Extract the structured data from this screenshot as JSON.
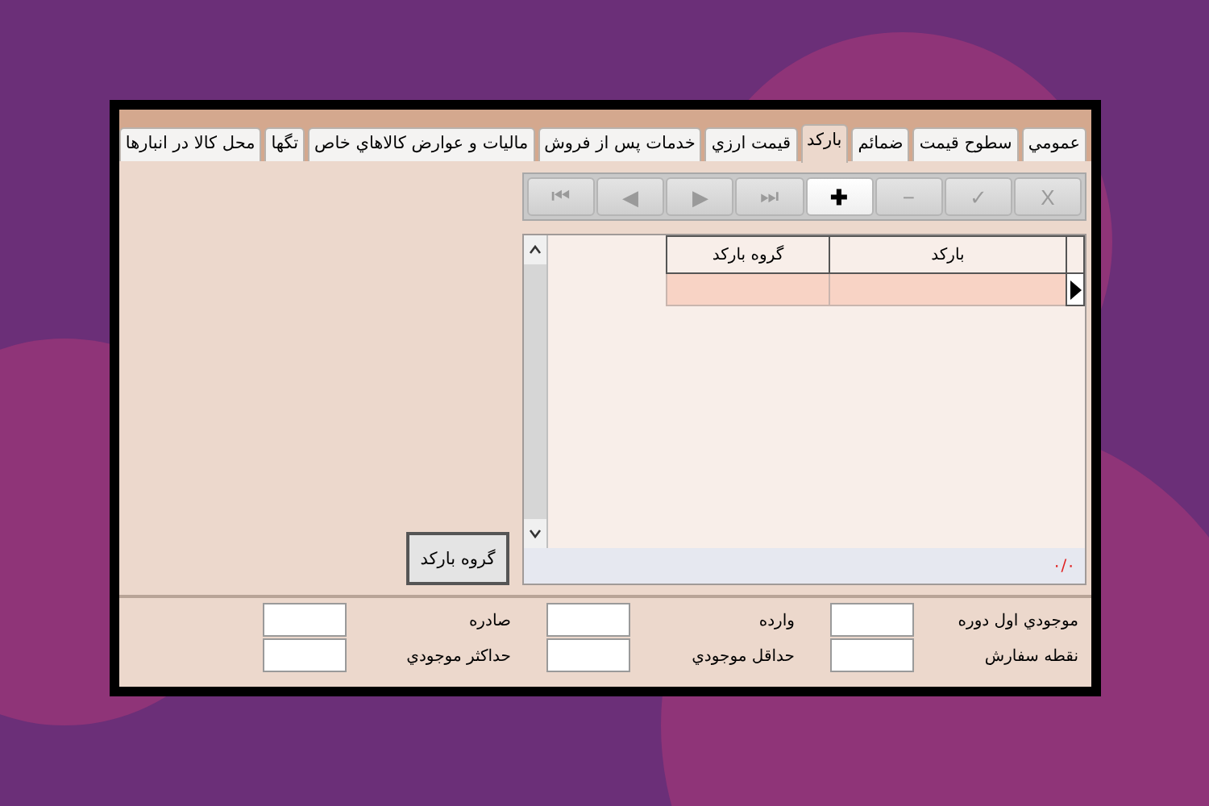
{
  "tabs": [
    {
      "label": "عمومي",
      "selected": false
    },
    {
      "label": "سطوح قيمت",
      "selected": false
    },
    {
      "label": "ضمائم",
      "selected": false
    },
    {
      "label": "بارکد",
      "selected": true
    },
    {
      "label": "قيمت ارزي",
      "selected": false
    },
    {
      "label": "خدمات پس از فروش",
      "selected": false
    },
    {
      "label": "ماليات و عوارض کالاهاي خاص",
      "selected": false
    },
    {
      "label": "تگها",
      "selected": false
    },
    {
      "label": "محل کالا در انبارها",
      "selected": false
    }
  ],
  "toolbar": [
    {
      "symbol": "X",
      "disabled": true
    },
    {
      "symbol": "✓",
      "disabled": true
    },
    {
      "symbol": "−",
      "disabled": true
    },
    {
      "symbol": "✚",
      "disabled": false
    },
    {
      "symbol": "⏭",
      "disabled": true
    },
    {
      "symbol": "▶",
      "disabled": true
    },
    {
      "symbol": "◀",
      "disabled": true
    },
    {
      "symbol": "⏮",
      "disabled": true
    }
  ],
  "grid": {
    "columns": [
      "بارکد",
      "گروه بارکد"
    ],
    "rows": [
      {
        "selected": true
      }
    ],
    "record_counter": "٠/٠"
  },
  "group_button": "گروه بارکد",
  "stock_fields": [
    {
      "label": "موجودي اول دوره"
    },
    {
      "label": "وارده"
    },
    {
      "label": "صادره"
    },
    {
      "label": "نقطه سفارش"
    },
    {
      "label": "حداقل موجودي"
    },
    {
      "label": "حداکثر موجودي"
    }
  ]
}
